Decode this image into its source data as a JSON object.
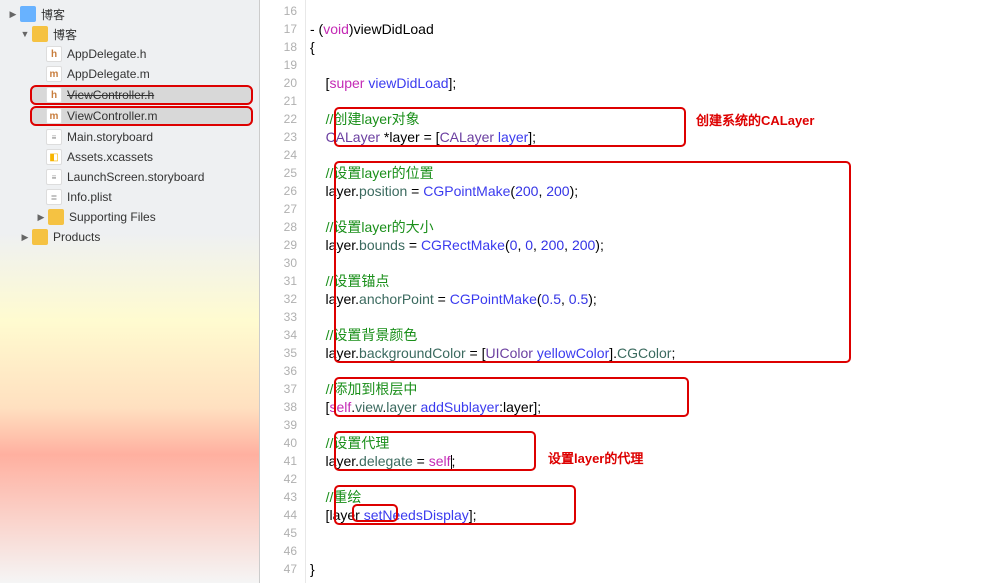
{
  "sidebar": {
    "root": "博客",
    "project": "博客",
    "files": {
      "appDelegateH": "AppDelegate.h",
      "appDelegateM": "AppDelegate.m",
      "viewControllerH": "ViewController.h",
      "viewControllerM": "ViewController.m",
      "mainSb": "Main.storyboard",
      "assets": "Assets.xcassets",
      "launchSb": "LaunchScreen.storyboard",
      "infoPlist": "Info.plist",
      "supporting": "Supporting Files",
      "products": "Products"
    }
  },
  "lines": {
    "start": 16,
    "end": 47
  },
  "code": {
    "l17": {
      "a": "- (",
      "b": "void",
      "c": ")viewDidLoad"
    },
    "l18": "{",
    "l20": {
      "a": "    [",
      "b": "super",
      "c": " ",
      "d": "viewDidLoad",
      "e": "];"
    },
    "l22": {
      "a": "    ",
      "b": "//创建layer对象"
    },
    "l23": {
      "a": "    ",
      "b": "CALayer",
      "c": " *layer = [",
      "d": "CALayer",
      "e": " ",
      "f": "layer",
      "g": "];"
    },
    "l25": {
      "a": "    ",
      "b": "//设置layer的位置"
    },
    "l26": {
      "a": "    layer.",
      "b": "position",
      "c": " = ",
      "d": "CGPointMake",
      "e": "(",
      "f": "200",
      "g": ", ",
      "h": "200",
      "i": ");"
    },
    "l28": {
      "a": "    ",
      "b": "//设置layer的大小"
    },
    "l29": {
      "a": "    layer.",
      "b": "bounds",
      "c": " = ",
      "d": "CGRectMake",
      "e": "(",
      "f": "0",
      "g": ", ",
      "h": "0",
      "i": ", ",
      "j": "200",
      "k": ", ",
      "l": "200",
      "m": ");"
    },
    "l31": {
      "a": "    ",
      "b": "//设置锚点"
    },
    "l32": {
      "a": "    layer.",
      "b": "anchorPoint",
      "c": " = ",
      "d": "CGPointMake",
      "e": "(",
      "f": "0.5",
      "g": ", ",
      "h": "0.5",
      "i": ");"
    },
    "l34": {
      "a": "    ",
      "b": "//设置背景颜色"
    },
    "l35": {
      "a": "    layer.",
      "b": "backgroundColor",
      "c": " = [",
      "d": "UIColor",
      "e": " ",
      "f": "yellowColor",
      "g": "].",
      "h": "CGColor",
      "i": ";"
    },
    "l37": {
      "a": "    ",
      "b": "//添加到根层中"
    },
    "l38": {
      "a": "    [",
      "b": "self",
      "c": ".",
      "d": "view",
      "e": ".",
      "f": "layer",
      "g": " ",
      "h": "addSublayer",
      "i": ":layer];"
    },
    "l40": {
      "a": "    ",
      "b": "//设置代理"
    },
    "l41": {
      "a": "    layer.",
      "b": "delegate",
      "c": " = ",
      "d": "self",
      "e": "",
      "f": ";"
    },
    "l43": {
      "a": "    ",
      "b": "//重绘"
    },
    "l44": {
      "a": "    [",
      "b": "layer",
      "c": " ",
      "d": "setNeedsDisplay",
      "e": "];"
    },
    "l47": "}"
  },
  "annotations": {
    "a1": "创建系统的CALayer",
    "a2": "设置layer的代理"
  }
}
